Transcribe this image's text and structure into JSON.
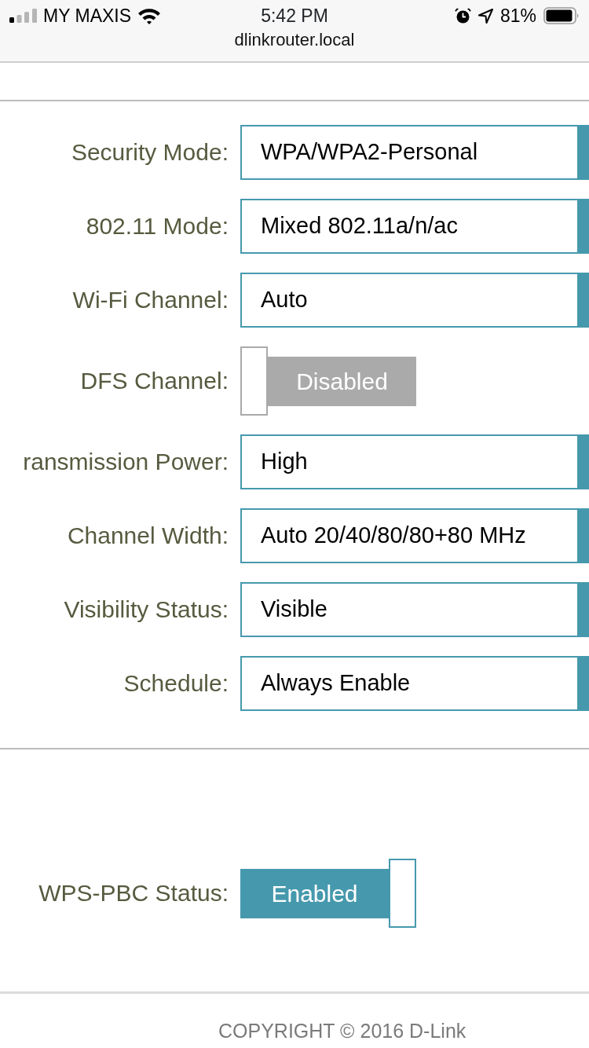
{
  "status_bar": {
    "carrier": "MY MAXIS",
    "time": "5:42 PM",
    "battery": "81%"
  },
  "address_bar": {
    "url": "dlinkrouter.local"
  },
  "wireless_settings": [
    {
      "label": "Security Mode:",
      "kind": "select",
      "value": "WPA/WPA2-Personal"
    },
    {
      "label": "802.11 Mode:",
      "kind": "select",
      "value": "Mixed 802.11a/n/ac"
    },
    {
      "label": "Wi-Fi Channel:",
      "kind": "select",
      "value": "Auto"
    },
    {
      "label": "DFS Channel:",
      "kind": "toggle",
      "on": false,
      "text": "Disabled"
    },
    {
      "label": "ransmission Power:",
      "kind": "select",
      "value": "High"
    },
    {
      "label": "Channel Width:",
      "kind": "select",
      "value": "Auto 20/40/80/80+80 MHz"
    },
    {
      "label": "Visibility Status:",
      "kind": "select",
      "value": "Visible"
    },
    {
      "label": "Schedule:",
      "kind": "select",
      "value": "Always Enable"
    }
  ],
  "wps_settings": [
    {
      "label": "WPS-PBC Status:",
      "kind": "toggle",
      "on": true,
      "text": "Enabled"
    }
  ],
  "footer": {
    "copyright": "COPYRIGHT © 2016 D-Link"
  }
}
